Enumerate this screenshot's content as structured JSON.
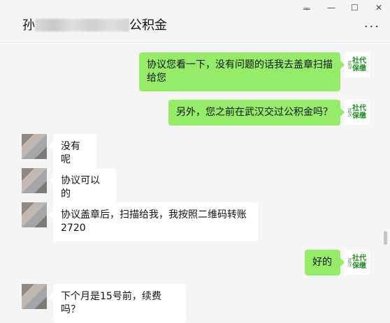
{
  "window": {
    "pin": "ᆍ",
    "minimize": "—",
    "maximize": "☐",
    "close": "✕"
  },
  "header": {
    "name_prefix": "孙",
    "name_suffix": "公积金",
    "more": "···"
  },
  "messages": [
    {
      "from": "me",
      "text": "协议您看一下，没有问题的话我去盖章扫描给您",
      "avatar_label_small": "武汉",
      "avatar_label_big": "社代保缴"
    },
    {
      "from": "me",
      "text": "另外，您之前在武汉交过公积金吗？",
      "avatar_label_small": "武汉",
      "avatar_label_big": "社代保缴"
    },
    {
      "from": "other",
      "text": "没有呢"
    },
    {
      "from": "other",
      "text": "协议可以的"
    },
    {
      "from": "other",
      "text": "协议盖章后，扫描给我，我按照二维码转账2720"
    },
    {
      "from": "me",
      "text": "好的",
      "avatar_label_small": "武汉",
      "avatar_label_big": "社代保缴"
    },
    {
      "from": "other",
      "text": "下个月是15号前，续费吗？"
    }
  ]
}
